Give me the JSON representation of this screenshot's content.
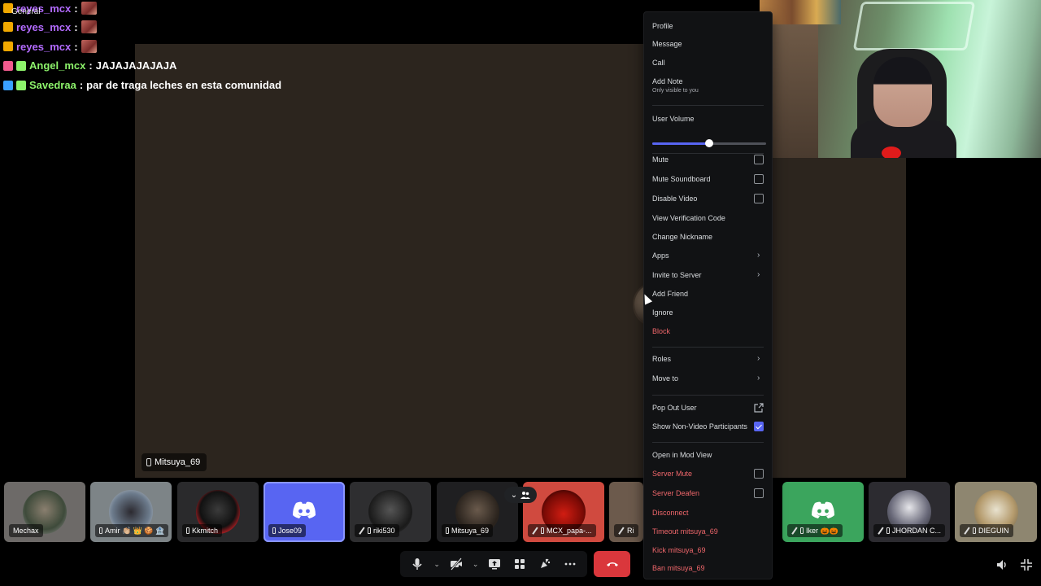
{
  "chat": {
    "channel_tag": "General",
    "lines": [
      {
        "user": "reyes_mcx",
        "sep": ":",
        "text": "",
        "color": "#b36bff"
      },
      {
        "user": "reyes_mcx",
        "sep": ":",
        "text": "",
        "color": "#b36bff"
      },
      {
        "user": "reyes_mcx",
        "sep": ":",
        "text": "",
        "color": "#b36bff"
      },
      {
        "user": "Angel_mcx",
        "sep": ":",
        "text": "JAJAJAJAJAJA",
        "color": "#8df36b"
      },
      {
        "user": "Savedraa",
        "sep": ":",
        "text": "par de traga leches en esta comunidad",
        "color": "#8df36b"
      }
    ]
  },
  "stage": {
    "user_label": "Mitsuya_69"
  },
  "participants": [
    {
      "name": "Mechax",
      "style": "photo"
    },
    {
      "name": "Amir 👏🏼 👑 🍪 🏦",
      "style": "photo"
    },
    {
      "name": "Kkmitch",
      "style": "photo"
    },
    {
      "name": "Jose09",
      "style": "discord-blue",
      "selected": true
    },
    {
      "name": "riki530",
      "style": "photo"
    },
    {
      "name": "Mitsuya_69",
      "style": "photo"
    },
    {
      "name": "MCX_papa-...",
      "style": "photo-red"
    },
    {
      "name": "Ri",
      "style": "photo"
    },
    {
      "name": "Iker 🎃🎃",
      "style": "discord-green"
    },
    {
      "name": "JHORDAN C...",
      "style": "photo"
    },
    {
      "name": "DIEGUIN",
      "style": "photo"
    }
  ],
  "context_menu": {
    "items": [
      {
        "label": "Profile"
      },
      {
        "label": "Message"
      },
      {
        "label": "Call"
      },
      {
        "label": "Add Note",
        "sub": "Only visible to you"
      },
      {
        "label": "User Volume",
        "volume_fraction": 0.5
      },
      {
        "label": "Mute",
        "checkbox": false
      },
      {
        "label": "Mute Soundboard",
        "checkbox": false
      },
      {
        "label": "Disable Video",
        "checkbox": false
      },
      {
        "label": "View Verification Code"
      },
      {
        "label": "Change Nickname"
      },
      {
        "label": "Apps",
        "submenu": true
      },
      {
        "label": "Invite to Server",
        "submenu": true
      },
      {
        "label": "Add Friend"
      },
      {
        "label": "Ignore"
      },
      {
        "label": "Block",
        "danger": true
      },
      {
        "label": "Roles",
        "submenu": true
      },
      {
        "label": "Move to",
        "submenu": true
      },
      {
        "label": "Pop Out User"
      },
      {
        "label": "Show Non-Video Participants",
        "checkbox": true
      },
      {
        "label": "Open in Mod View"
      },
      {
        "label": "Server Mute",
        "checkbox": false,
        "danger": true
      },
      {
        "label": "Server Deafen",
        "checkbox": false,
        "danger": true
      },
      {
        "label": "Disconnect",
        "danger": true
      },
      {
        "label": "Timeout mitsuya_69",
        "danger": true
      },
      {
        "label": "Kick mitsuya_69",
        "danger": true
      },
      {
        "label": "Ban mitsuya_69",
        "danger": true
      }
    ]
  },
  "controls": {
    "mic_icon": "microphone-icon",
    "camera_icon": "camera-off-icon",
    "share_icon": "screen-share-icon",
    "activity_icon": "activities-icon",
    "soundboard_icon": "soundboard-icon",
    "more_icon": "more-icon",
    "hangup_icon": "hangup-icon",
    "volume_icon": "volume-icon",
    "fullscreen_icon": "exit-fullscreen-icon"
  },
  "colors": {
    "blurple": "#5865f2",
    "danger": "#f0676b",
    "hangup": "#da373c",
    "discord_green": "#3ba55d"
  }
}
